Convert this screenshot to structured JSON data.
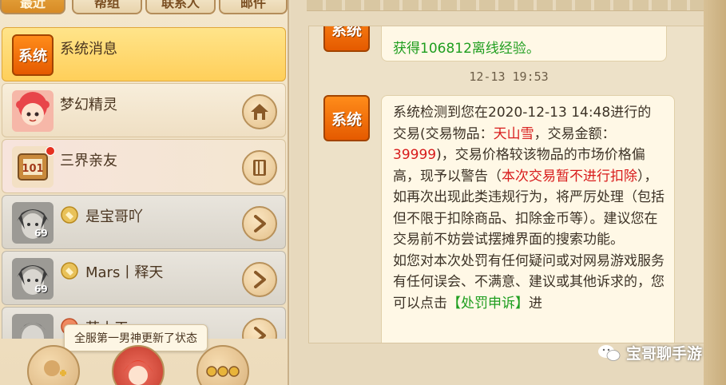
{
  "tabs": [
    "最近",
    "帮组",
    "联系人",
    "邮件"
  ],
  "contacts": [
    {
      "name": "系统消息",
      "avatar_text": "系统"
    },
    {
      "name": "梦幻精灵"
    },
    {
      "name": "三界亲友"
    },
    {
      "name": "是宝哥吖",
      "level": "69"
    },
    {
      "name": "Mars丨释天",
      "level": "69"
    },
    {
      "name": "苏小天"
    }
  ],
  "tooltip": "全服第一男神更新了状态",
  "chat": {
    "avatar_text": "系统",
    "msg1_line1": "获得106812离线经验。",
    "timestamp": "12-13  19:53",
    "msg2": {
      "p1_a": "系统检测到您在2020-12-13 14:48进行的交易(交易物品：",
      "item": "天山雪",
      "p1_b": "，交易金额：",
      "amount": "39999",
      "p1_c": ")，交易价格较该物品的市场价格偏高，现予以警告（",
      "warn": "本次交易暂不进行扣除",
      "p1_d": "），如再次出现此类违规行为，将严厉处理（包括但不限于扣除商品、扣除金币等）。建议您在交易前不妨尝试摆摊界面的搜索功能。",
      "p2_a": "如您对本次处罚有任何疑问或对网易游戏服务有任何误会、不满意、建议或其他诉求的，您可以点击",
      "link": "【处罚申诉】",
      "p2_b": "进"
    }
  },
  "watermark": "宝哥聊手游"
}
